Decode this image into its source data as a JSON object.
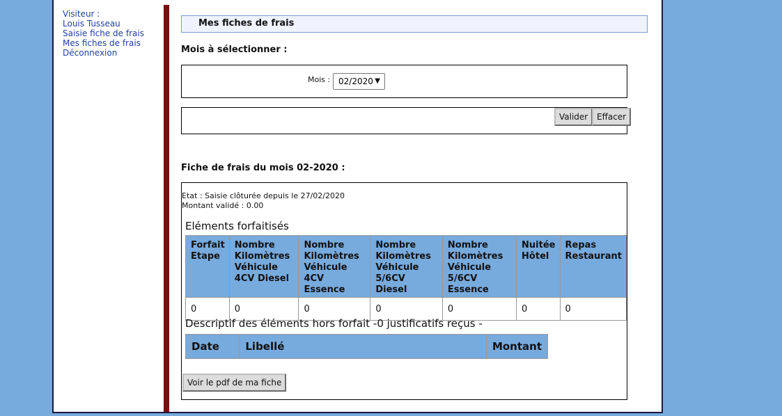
{
  "menu": {
    "visitor_label": "Visiteur :",
    "visitor_name": "Louis Tusseau",
    "saisie": "Saisie fiche de frais",
    "mes_fiches": "Mes fiches de frais",
    "deconnexion": "Déconnexion"
  },
  "header": {
    "title": "Mes fiches de frais"
  },
  "mois_section": {
    "heading": "Mois à sélectionner :",
    "label": "Mois :",
    "selected": "02/2020"
  },
  "buttons": {
    "valider": "Valider",
    "effacer": "Effacer",
    "pdf": "Voir le pdf de ma fiche"
  },
  "fiche": {
    "heading": "Fiche de frais du mois 02-2020 :",
    "etat": "Etat : Saisie clôturée depuis le 27/02/2020",
    "montant": "Montant validé : 0.00",
    "forfait_title": "Eléments forfaitisés",
    "forfait_headers": [
      "Forfait Etape",
      "Nombre Kilomètres Véhicule 4CV Diesel",
      "Nombre Kilomètres Véhicule 4CV Essence",
      "Nombre Kilomètres Véhicule 5/6CV Diesel",
      "Nombre Kilomètres Véhicule 5/6CV Essence",
      "Nuitée Hôtel",
      "Repas Restaurant"
    ],
    "forfait_values": [
      "0",
      "0",
      "0",
      "0",
      "0",
      "0",
      "0"
    ],
    "hors_title": "Descriptif des éléments hors forfait -0 justificatifs reçus -",
    "hors_headers": [
      "Date",
      "Libellé",
      "Montant"
    ]
  },
  "colors": {
    "background": "#77aadd",
    "divider": "#7a0f0f",
    "header_cell": "#77aadd",
    "link": "#1f3fa0"
  }
}
